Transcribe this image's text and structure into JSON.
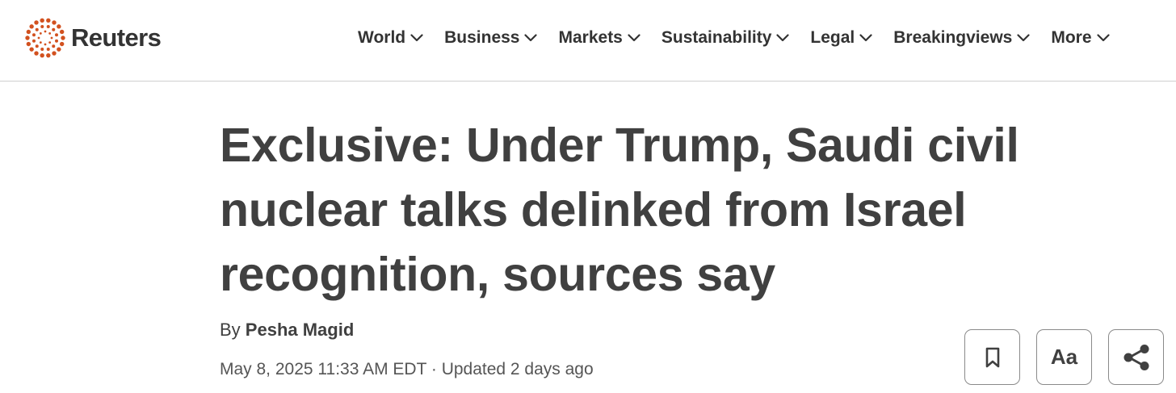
{
  "header": {
    "logo_text": "Reuters",
    "logo_icon": "reuters-dot-ring-icon",
    "brand_color": "#d2511f",
    "nav": [
      {
        "label": "World",
        "icon": "chevron-down-icon"
      },
      {
        "label": "Business",
        "icon": "chevron-down-icon"
      },
      {
        "label": "Markets",
        "icon": "chevron-down-icon"
      },
      {
        "label": "Sustainability",
        "icon": "chevron-down-icon"
      },
      {
        "label": "Legal",
        "icon": "chevron-down-icon"
      },
      {
        "label": "Breakingviews",
        "icon": "chevron-down-icon"
      },
      {
        "label": "More",
        "icon": "chevron-down-icon"
      }
    ]
  },
  "article": {
    "headline_lines": [
      "Exclusive: Under Trump, Saudi civil",
      "nuclear talks delinked from Israel",
      "recognition, sources say"
    ],
    "byline_prefix": "By ",
    "author": "Pesha Magid",
    "dateline": "May 8, 2025 11:33 AM EDT · Updated 2 days ago"
  },
  "actions": {
    "bookmark_icon": "bookmark-icon",
    "text_size_label": "Aa",
    "share_icon": "share-icon"
  }
}
